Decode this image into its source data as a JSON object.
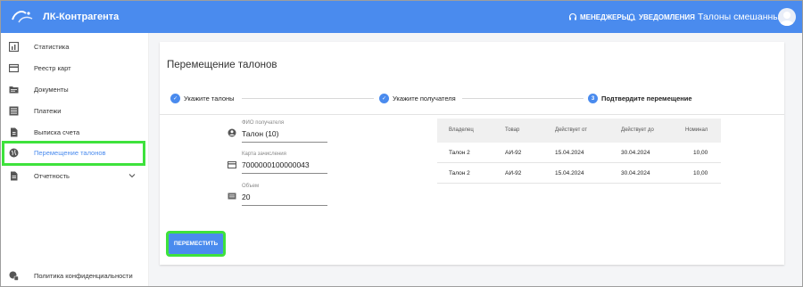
{
  "header": {
    "app_title": "ЛК-Контрагента",
    "managers": "МЕНЕДЖЕРЫ",
    "notifications": "УВЕДОМЛЕНИЯ",
    "user_name": "Талоны смешанные"
  },
  "sidebar": {
    "items": [
      {
        "label": "Статистика",
        "icon": "bar-chart-icon"
      },
      {
        "label": "Реестр карт",
        "icon": "credit-card-icon"
      },
      {
        "label": "Документы",
        "icon": "folder-icon"
      },
      {
        "label": "Платежи",
        "icon": "list-icon"
      },
      {
        "label": "Выписка счета",
        "icon": "receipt-icon"
      },
      {
        "label": "Перемещение талонов",
        "icon": "globe-icon",
        "active": true
      },
      {
        "label": "Отчетность",
        "icon": "document-icon"
      },
      {
        "label": "Политика конфиденциальности",
        "icon": "privacy-icon"
      }
    ]
  },
  "page": {
    "title": "Перемещение талонов",
    "steps": [
      {
        "label": "Укажите талоны",
        "marker": "✓"
      },
      {
        "label": "Укажите получателя",
        "marker": "✓"
      },
      {
        "label": "Подтвердите перемещение",
        "marker": "3"
      }
    ]
  },
  "form": {
    "recipient_label": "ФИО получателя",
    "recipient_value": "Талон (10)",
    "card_label": "Карта зачисления",
    "card_value": "7000000100000043",
    "volume_label": "Объем",
    "volume_value": "20"
  },
  "table": {
    "headers": [
      "Владелец",
      "Товар",
      "Действует от",
      "Действует до",
      "Номинал"
    ],
    "rows": [
      [
        "Талон 2",
        "АИ-92",
        "15.04.2024",
        "30.04.2024",
        "10,00"
      ],
      [
        "Талон 2",
        "АИ-92",
        "15.04.2024",
        "30.04.2024",
        "10,00"
      ]
    ]
  },
  "actions": {
    "move_label": "ПЕРЕМЕСТИТЬ"
  },
  "colors": {
    "accent": "#4a8bee",
    "highlight": "#3ee23c",
    "background": "#f4f5f7"
  }
}
